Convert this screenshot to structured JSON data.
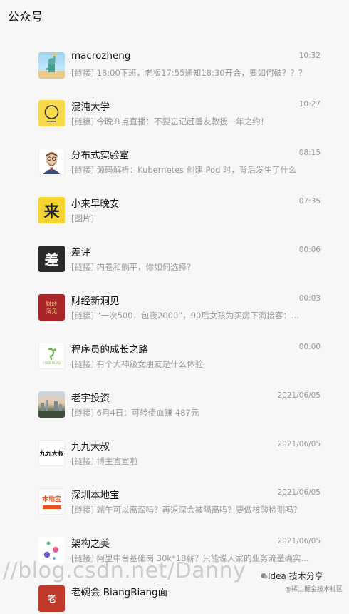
{
  "header": {
    "title": "公众号"
  },
  "items": [
    {
      "name": "macrozheng",
      "time": "10:32",
      "message": "[链接] 18:00下班，老板17:55通知18:30开会，要如何破？？？",
      "avatar": {
        "icon": "statue-avatar-icon"
      }
    },
    {
      "name": "混沌大学",
      "time": "10:27",
      "message": "[链接] 今晚８点直播：不要忘记赶善友教授一年之约！",
      "avatar": {
        "icon": "hundun-logo-icon"
      }
    },
    {
      "name": "分布式实验室",
      "time": "08:15",
      "message": "[链接] 源码解析：Kubernetes 创建 Pod 时，背后发生了什么",
      "avatar": {
        "icon": "bearded-man-avatar-icon"
      }
    },
    {
      "name": "小来早晚安",
      "time": "07:35",
      "message": "[图片]",
      "avatar": {
        "icon": "lai-character-icon",
        "text": "来"
      }
    },
    {
      "name": "差评",
      "time": "00:06",
      "message": "[链接] 内卷和躺平，你如何选择?",
      "avatar": {
        "icon": "chaping-logo-icon",
        "text": "差"
      }
    },
    {
      "name": "财经新洞见",
      "time": "00:03",
      "message": "[链接] “一次500，包夜2000”，90后女孩为买房下海接客：...",
      "avatar": {
        "icon": "caijing-logo-icon",
        "text": "财经洞见"
      }
    },
    {
      "name": "程序员的成长之路",
      "time": "00:00",
      "message": "[链接] 有个大神级女朋友是什么体验",
      "avatar": {
        "icon": "code-road-logo-icon",
        "text": "CODE ROAD"
      }
    },
    {
      "name": "老宇投资",
      "time": "2021/06/05",
      "message": "[链接] 6月4日：可转债血赚 487元",
      "avatar": {
        "icon": "city-photo-avatar-icon"
      }
    },
    {
      "name": "九九大叔",
      "time": "2021/06/05",
      "message": "[链接] 博主官宣啦",
      "avatar": {
        "icon": "jiujiu-logo-icon",
        "text": "九九大叔"
      }
    },
    {
      "name": "深圳本地宝",
      "time": "2021/06/05",
      "message": "[链接] 端午可以离深吗？再返深会被隔离吗？要做核酸检测吗？",
      "avatar": {
        "icon": "bendibao-logo-icon",
        "text": "本地宝"
      }
    },
    {
      "name": "架构之美",
      "time": "2021/06/05",
      "message": "[链接] 阿里中台基础岗 30k*18薪？只能说人家的业务流量确实...",
      "avatar": {
        "icon": "dots-logo-icon"
      }
    },
    {
      "name": "老碗会 BiangBiang面",
      "time": "",
      "message": "",
      "avatar": {
        "icon": "laowan-logo-icon",
        "text": "老"
      }
    }
  ],
  "watermark": {
    "text": "//blog.csdn.net/Danny",
    "brand": "Idea 技术分享",
    "sub": "@稀土掘金技术社区"
  },
  "colors": {
    "background": "#f7f7f7",
    "title": "#111111",
    "secondary": "#9a9a9a",
    "divider": "#e6e6e6"
  }
}
